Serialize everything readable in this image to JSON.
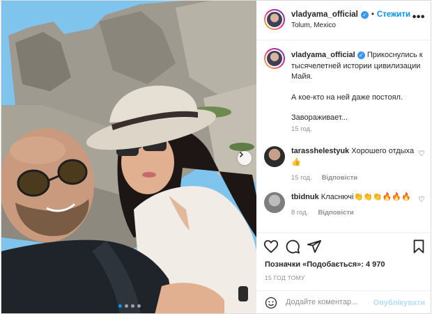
{
  "post": {
    "username": "vladyama_official",
    "follow_label": "Стежити",
    "location": "Tolum, Mexico",
    "more_icon": "more-horizontal-icon",
    "caption": {
      "username": "vladyama_official",
      "text": "Прикоснулись к тысячелетней истории цивилизации Майя.",
      "line2": "А кое-кто на ней даже постоял.",
      "line3": "Завораживает...",
      "time": "15 год."
    },
    "comments": [
      {
        "username": "tarasshelestyuk",
        "text": "Хорошего отдыха 👍",
        "time": "15 год.",
        "reply_label": "Відповісти"
      },
      {
        "username": "tbidnuk",
        "text": "Класнючі👏👏👏🔥🔥🔥",
        "time": "8 год.",
        "reply_label": "Відповісти"
      }
    ],
    "likes_label": "Позначки «Подобається»: 4 970",
    "date_label": "15 ГОД ТОМУ",
    "add_comment": {
      "placeholder": "Додайте коментар...",
      "publish_label": "Опублікувати"
    },
    "carousel": {
      "total": 4,
      "active": 1
    },
    "colors": {
      "accent": "#0095f6",
      "verified": "#3897f0",
      "muted": "#8e8e8e",
      "publish_disabled": "#b2dffc"
    }
  }
}
